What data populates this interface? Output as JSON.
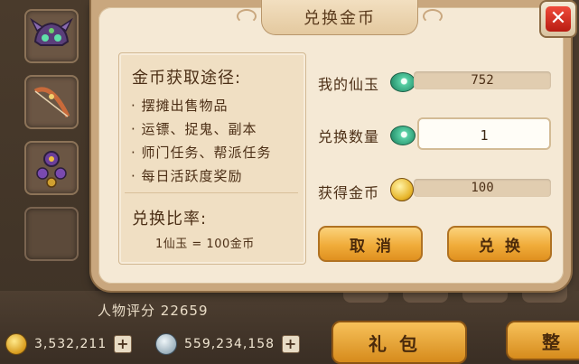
{
  "dialog": {
    "title": "兑换金币",
    "close_label": "✕"
  },
  "info": {
    "ways_title": "金币获取途径:",
    "ways": [
      "摆摊出售物品",
      "运镖、捉鬼、副本",
      "师门任务、帮派任务",
      "每日活跃度奖励"
    ],
    "ratio_title": "兑换比率:",
    "ratio_text": "1仙玉 = 100金币"
  },
  "rows": {
    "jade_label": "我的仙玉",
    "jade_value": "752",
    "qty_label": "兑换数量",
    "qty_value": "1",
    "gold_label": "获得金币",
    "gold_value": "100"
  },
  "buttons": {
    "cancel": "取消",
    "confirm": "兑换"
  },
  "background": {
    "score_label": "人物评分",
    "score_value": "22659",
    "gold_amount": "3,532,211",
    "silver_amount": "559,234,158",
    "gift_button": "礼包",
    "sort_button": "整"
  },
  "icons": {
    "jade": "jade-icon",
    "gold": "gold-coin-icon",
    "silver": "silver-coin-icon",
    "close": "close-icon"
  },
  "colors": {
    "panel": "#f5e9d5",
    "button": "#f0ac3a",
    "close": "#d9261a"
  }
}
